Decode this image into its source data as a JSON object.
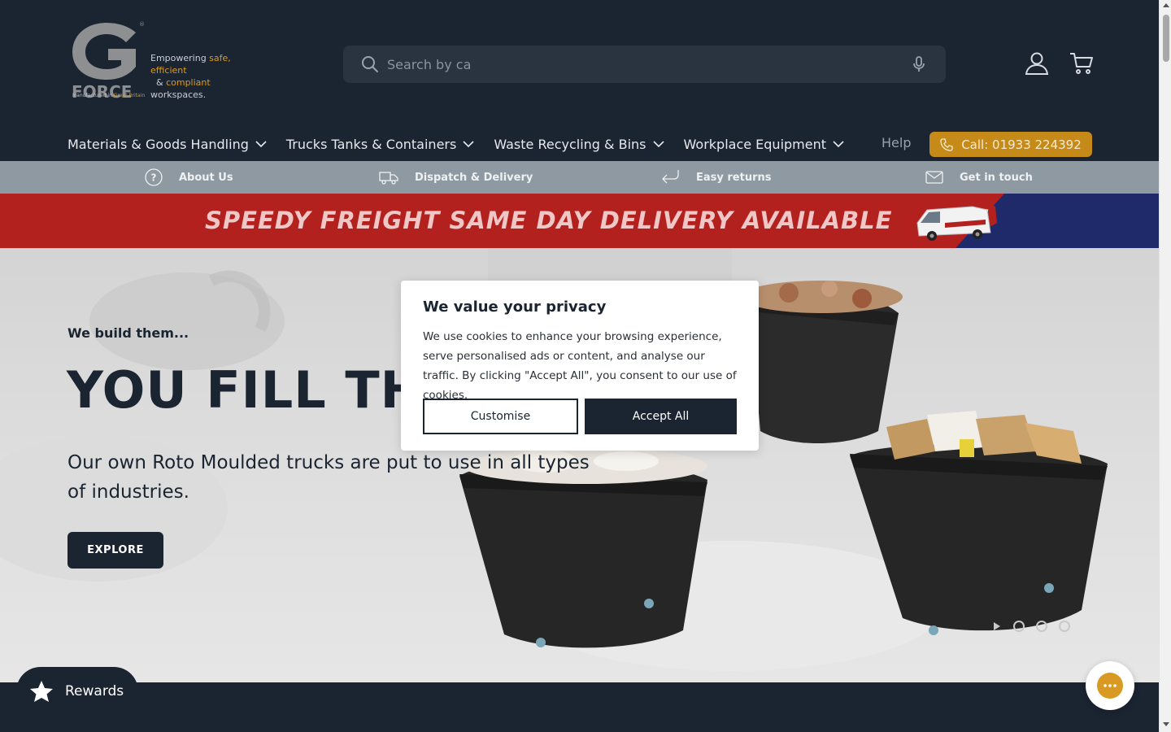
{
  "brand": {
    "logo_letter": "G",
    "logo_word": "FORCE",
    "tagline_prefix": "Empowering ",
    "tagline_safe": "safe, efficient",
    "tagline_amp": "& ",
    "tagline_compliant": "compliant",
    "tagline_suffix": " workspaces.",
    "made_in_prefix": "Manufactured in ",
    "made_in_country": "Great Britain",
    "accent_color": "#d89a22"
  },
  "search": {
    "placeholder": "Search by ca"
  },
  "header": {
    "icons": [
      "search-icon",
      "microphone-icon",
      "account-icon",
      "cart-icon"
    ]
  },
  "nav": {
    "items": [
      {
        "label": "Materials & Goods Handling"
      },
      {
        "label": "Trucks Tanks & Containers"
      },
      {
        "label": "Waste Recycling & Bins"
      },
      {
        "label": "Workplace Equipment"
      }
    ],
    "help": "Help",
    "call": "Call: 01933 224392"
  },
  "strip": {
    "items": [
      {
        "label": "About Us",
        "icon": "question-icon"
      },
      {
        "label": "Dispatch & Delivery",
        "icon": "truck-icon"
      },
      {
        "label": "Easy returns",
        "icon": "return-arrow-icon"
      },
      {
        "label": "Get in touch",
        "icon": "envelope-icon"
      }
    ]
  },
  "promo": {
    "text": "SPEEDY FREIGHT SAME DAY DELIVERY AVAILABLE"
  },
  "hero": {
    "eyebrow": "We build them...",
    "title": "YOU FILL THEM",
    "text": "Our own Roto Moulded trucks are put to use in all types of industries.",
    "cta": "EXPLORE"
  },
  "cookie": {
    "title": "We value your privacy",
    "body": "We use cookies to enhance your browsing experience, serve personalised ads or content, and analyse our traffic. By clicking \"Accept All\", you consent to our use of cookies.",
    "customise": "Customise",
    "accept": "Accept All"
  },
  "rewards": {
    "label": "Rewards"
  },
  "colors": {
    "header_bg": "#1b2431",
    "strip_bg": "#8e99a2",
    "promo_red": "#b3211f",
    "promo_blue": "#1f2a6b",
    "call_button": "#c58a17"
  }
}
